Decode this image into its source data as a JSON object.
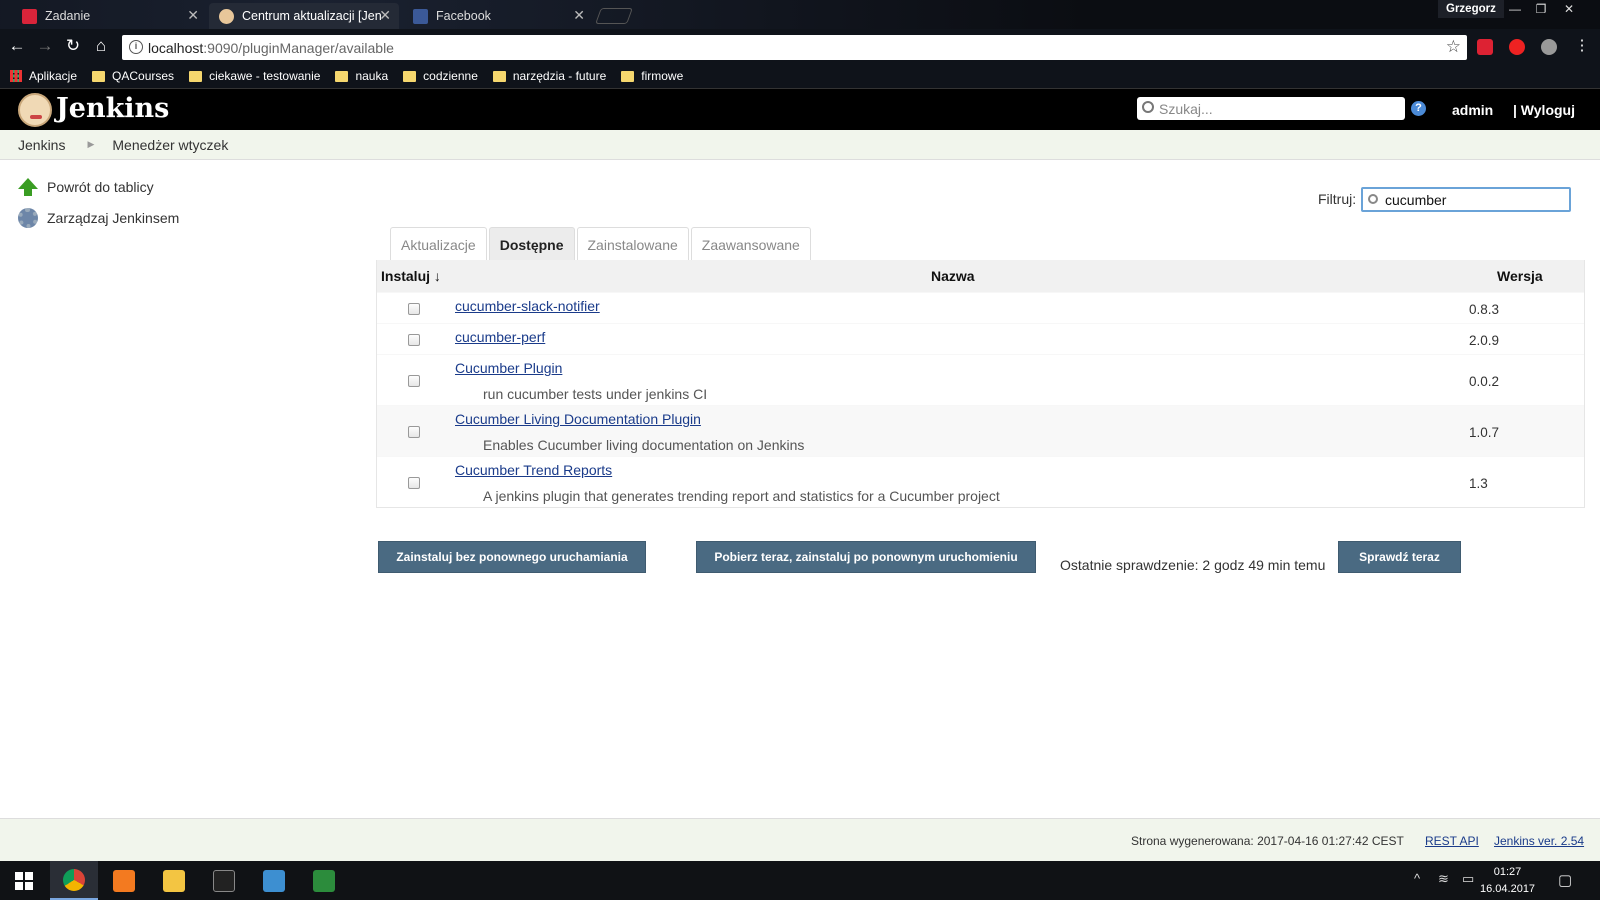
{
  "browser": {
    "tabs": [
      {
        "label": "Zadanie",
        "active": false
      },
      {
        "label": "Centrum aktualizacji [Jen",
        "active": true
      },
      {
        "label": "Facebook",
        "active": false
      }
    ],
    "user": "Grzegorz",
    "url_host": "localhost",
    "url_rest": ":9090/pluginManager/available",
    "bookmarks": [
      "Aplikacje",
      "QACourses",
      "ciekawe - testowanie",
      "nauka",
      "codzienne",
      "narzędzia - future",
      "firmowe"
    ]
  },
  "jenkins": {
    "title": "Jenkins",
    "search_placeholder": "Szukaj...",
    "help_glyph": "?",
    "user": "admin",
    "logout": "| Wyloguj",
    "breadcrumb": [
      "Jenkins",
      "Menedżer wtyczek"
    ]
  },
  "sidebar": [
    {
      "label": "Powrót do tablicy",
      "icon": "up-arrow-icon"
    },
    {
      "label": "Zarządzaj Jenkinsem",
      "icon": "gear-icon"
    }
  ],
  "filter": {
    "label": "Filtruj:",
    "value": "cucumber"
  },
  "plugin_tabs": [
    {
      "label": "Aktualizacje",
      "active": false
    },
    {
      "label": "Dostępne",
      "active": true
    },
    {
      "label": "Zainstalowane",
      "active": false
    },
    {
      "label": "Zaawansowane",
      "active": false
    }
  ],
  "table": {
    "headers": {
      "install": "Instaluj ↓",
      "name": "Nazwa",
      "version": "Wersja"
    },
    "rows": [
      {
        "name": "cucumber-slack-notifier",
        "desc": "",
        "version": "0.8.3",
        "checked": false
      },
      {
        "name": "cucumber-perf",
        "desc": "",
        "version": "2.0.9",
        "checked": false
      },
      {
        "name": "Cucumber Plugin",
        "desc": "run cucumber tests under jenkins CI",
        "version": "0.0.2",
        "checked": false
      },
      {
        "name": "Cucumber Living Documentation Plugin",
        "desc": "Enables Cucumber living documentation on Jenkins",
        "version": "1.0.7",
        "checked": false
      },
      {
        "name": "Cucumber Trend Reports",
        "desc": "A jenkins plugin that generates trending report and statistics for a Cucumber project",
        "version": "1.3",
        "checked": false
      }
    ]
  },
  "actions": {
    "install_now": "Zainstaluj bez ponownego uruchamiania",
    "download_restart": "Pobierz teraz, zainstaluj po ponownym uruchomieniu",
    "last_check": "Ostatnie sprawdzenie: 2 godz 49 min temu",
    "check_now": "Sprawdź teraz"
  },
  "footer": {
    "generated": "Strona wygenerowana: 2017-04-16 01:27:42 CEST",
    "rest_api": "REST API",
    "version": "Jenkins ver. 2.54"
  },
  "taskbar": {
    "time": "01:27",
    "date": "16.04.2017"
  }
}
